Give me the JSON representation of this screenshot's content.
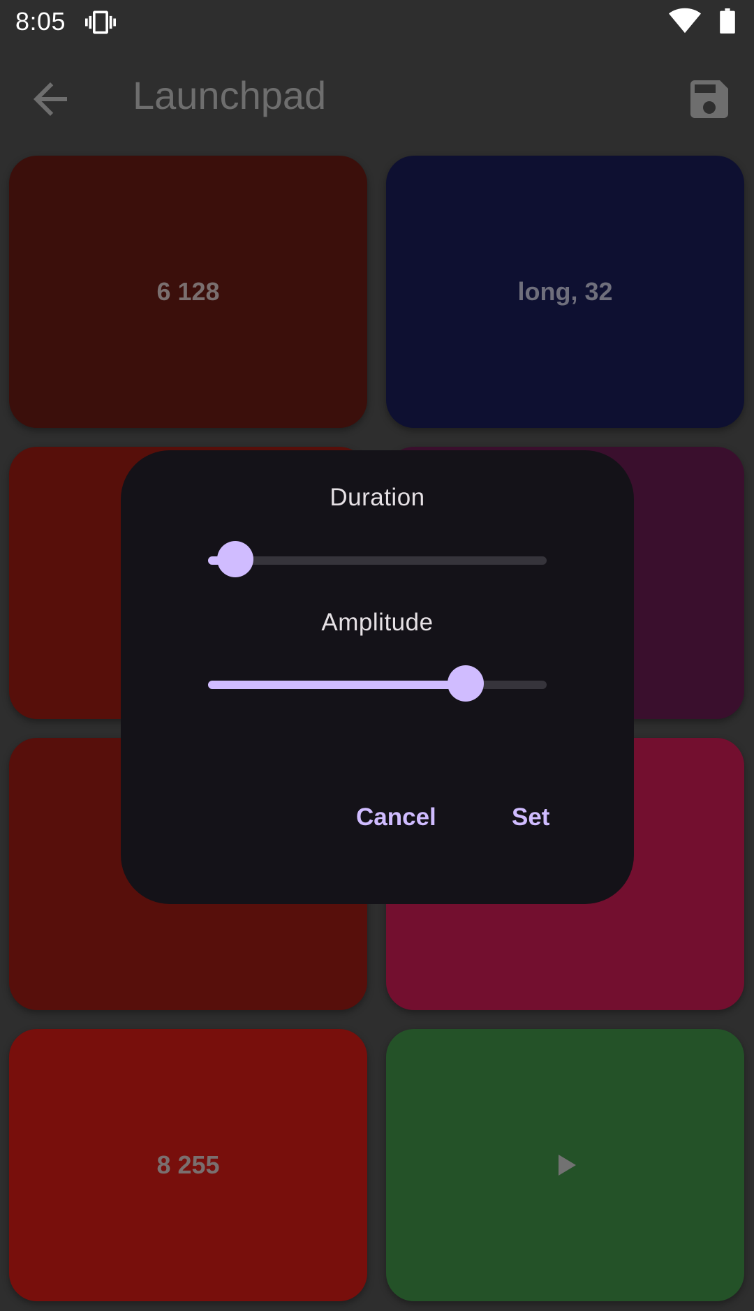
{
  "status_bar": {
    "time": "8:05"
  },
  "app_bar": {
    "title": "Launchpad"
  },
  "pads": [
    {
      "label": "6 128",
      "color": "#3b0f0b"
    },
    {
      "label": "long, 32",
      "color": "#0e1031"
    },
    {
      "label": "",
      "color": "#570f0a"
    },
    {
      "label": "",
      "color": "#3a0f2d"
    },
    {
      "label": "",
      "color": "#570f0b"
    },
    {
      "label": "",
      "color": "#730f2f"
    },
    {
      "label": "8 255",
      "color": "#780f0c"
    },
    {
      "label": "",
      "color": "#245228",
      "icon": "play-icon"
    }
  ],
  "dialog": {
    "duration": {
      "title": "Duration",
      "value_fraction": 0.08
    },
    "amplitude": {
      "title": "Amplitude",
      "value_fraction": 0.76
    },
    "cancel_label": "Cancel",
    "set_label": "Set"
  },
  "colors": {
    "accent": "#d0bcff",
    "dialog_bg": "#141218",
    "background": "#2e2e2e"
  }
}
